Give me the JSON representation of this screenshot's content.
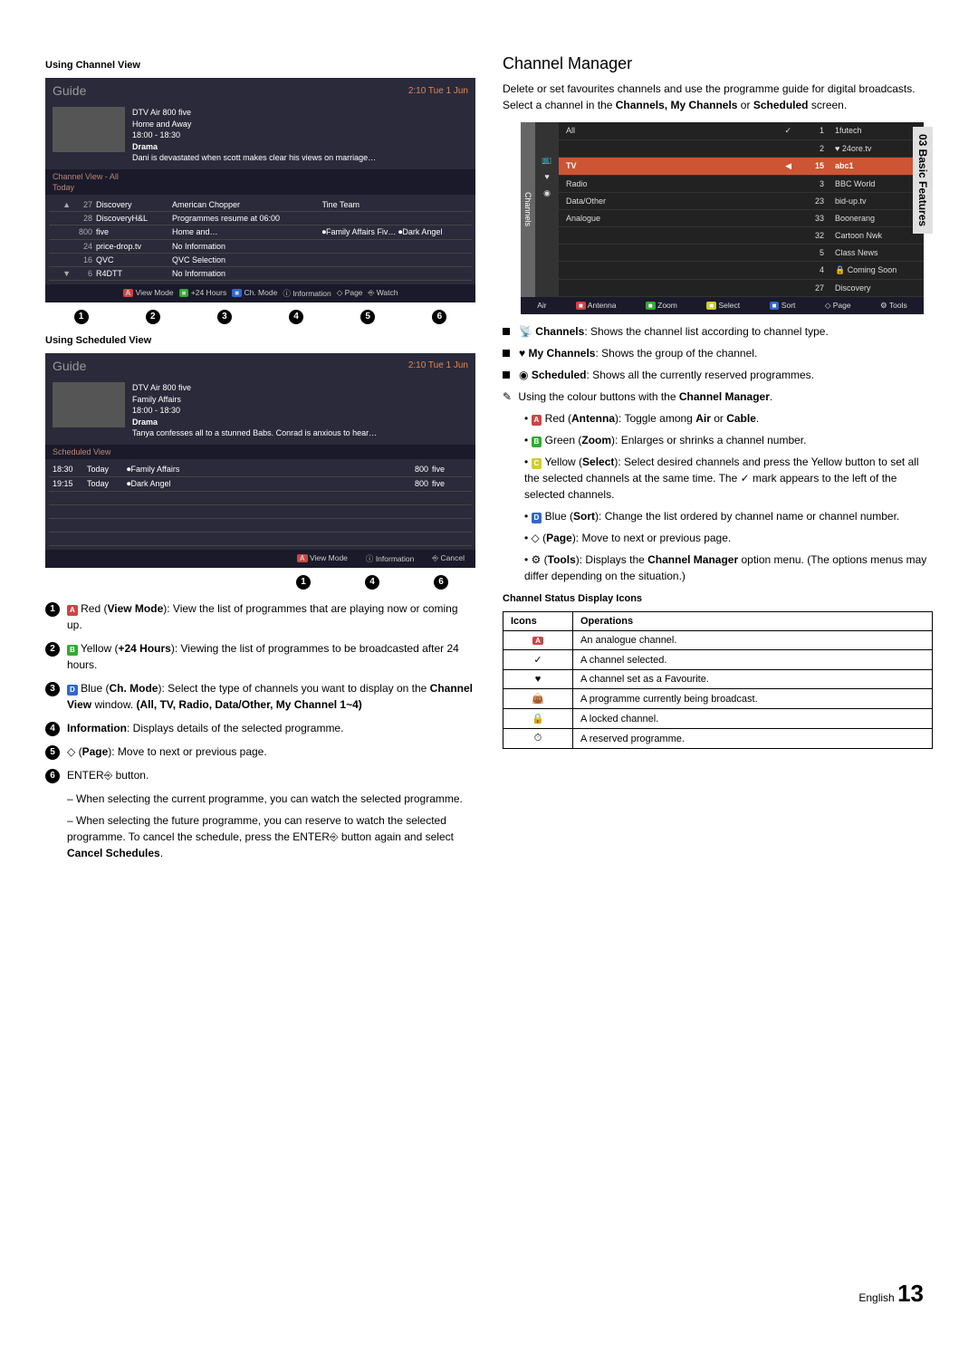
{
  "side_tab": "03 Basic Features",
  "page_footer_lang": "English",
  "page_footer_num": "13",
  "left": {
    "heading_cv": "Using Channel View",
    "heading_sv": "Using Scheduled View",
    "guide_title": "Guide",
    "guide_time": "2:10 Tue 1 Jun",
    "cv_preview": {
      "line1": "DTV Air 800 five",
      "line2": "Home and Away",
      "line3": "18:00 - 18:30",
      "line4_bold": "Drama",
      "line5": "Dani is devastated when scott makes clear his views on marriage…"
    },
    "cv_header": "Channel View - All",
    "cv_today": "Today",
    "cv_rows": [
      {
        "arrow": "▲",
        "num": "27",
        "name": "Discovery",
        "a": "American Chopper",
        "b": "Tine Team"
      },
      {
        "arrow": "",
        "num": "28",
        "name": "DiscoveryH&L",
        "a": "Programmes resume at 06:00",
        "b": ""
      },
      {
        "arrow": "",
        "num": "800",
        "name": "five",
        "a": "Home and…",
        "b": "⏺Family Affairs   Fiv…   ⏺Dark Angel"
      },
      {
        "arrow": "",
        "num": "24",
        "name": "price-drop.tv",
        "a": "No Information",
        "b": ""
      },
      {
        "arrow": "",
        "num": "16",
        "name": "QVC",
        "a": "QVC Selection",
        "b": ""
      },
      {
        "arrow": "▼",
        "num": "6",
        "name": "R4DTT",
        "a": "No Information",
        "b": ""
      }
    ],
    "cv_legend": {
      "viewmode_btn": "A",
      "viewmode": "View Mode",
      "hours_btn": "■",
      "hours": "+24 Hours",
      "chmode_btn": "■",
      "chmode": "Ch. Mode",
      "info_icon": "ⓘ",
      "info": "Information",
      "page_icon": "◇",
      "page": "Page",
      "watch_icon": "⎆",
      "watch": "Watch"
    },
    "callouts_row": [
      "1",
      "2",
      "3",
      "4",
      "5",
      "6"
    ],
    "sv_preview": {
      "line1": "DTV Air 800 five",
      "line2": "Family Affairs",
      "line3": "18:00 - 18:30",
      "line4_bold": "Drama",
      "line5": "Tanya confesses all to a stunned Babs. Conrad is anxious to hear…"
    },
    "sv_header": "Scheduled View",
    "sv_rows": [
      {
        "t": "18:30",
        "d": "Today",
        "p": "⏺Family Affairs",
        "c1": "800",
        "c2": "five"
      },
      {
        "t": "19:15",
        "d": "Today",
        "p": "⏺Dark Angel",
        "c1": "800",
        "c2": "five"
      }
    ],
    "sv_legend": {
      "viewmode_btn": "A",
      "viewmode": "View Mode",
      "info_icon": "ⓘ",
      "info": "Information",
      "cancel_icon": "⎆",
      "cancel": "Cancel"
    },
    "sv_callouts": [
      "1",
      "4",
      "6"
    ],
    "descriptions": {
      "d1_btn": "A",
      "d1_lead": "Red (",
      "d1_bold": "View Mode",
      "d1_tail": "): View the list of programmes that are playing now or coming up.",
      "d2_btn": "B",
      "d2_lead": "Yellow (",
      "d2_bold": "+24 Hours",
      "d2_tail": "): Viewing the list of programmes to be broadcasted after 24 hours.",
      "d3_btn": "D",
      "d3_lead": "Blue (",
      "d3_bold": "Ch. Mode",
      "d3_tail_a": "): Select the type of channels you want to display on the ",
      "d3_bold2": "Channel View",
      "d3_tail_b": " window. ",
      "d3_bold3": "(All, TV, Radio, Data/Other, My Channel 1~4)",
      "d4_bold": "Information",
      "d4_tail": ": Displays details of the selected programme.",
      "d5_icon": "◇",
      "d5_lead": " (",
      "d5_bold": "Page",
      "d5_tail": "): Move to next or previous page.",
      "d6_lead": "ENTER",
      "d6_icon": "⎆",
      "d6_tail": " button.",
      "d6_sub1": "When selecting the current programme, you can watch the selected programme.",
      "d6_sub2_a": "When selecting the future programme, you can reserve to watch the selected programme. To cancel the schedule, press the ENTER",
      "d6_sub2_icon": "⎆",
      "d6_sub2_b": " button again and select ",
      "d6_sub2_bold": "Cancel Schedules",
      "d6_sub2_c": "."
    }
  },
  "right": {
    "title": "Channel Manager",
    "intro_a": "Delete or set favourites channels and use the programme guide for digital broadcasts. Select a channel in the ",
    "intro_b_bold": "Channels, My Channels",
    "intro_c": " or ",
    "intro_d_bold": "Scheduled",
    "intro_e": " screen.",
    "cm_sidebar": "Channels",
    "cm_rows": [
      {
        "sym": "",
        "cat": "All",
        "col3": "✓",
        "num": "1",
        "name": "1futech"
      },
      {
        "sym": "",
        "cat": "",
        "col3": "",
        "num": "2",
        "name": "♥ 24ore.tv"
      },
      {
        "sym": "📺",
        "cat": "TV",
        "col3": "◀",
        "num": "15",
        "name": "abc1",
        "sel": true
      },
      {
        "sym": "♥",
        "cat": "Radio",
        "col3": "",
        "num": "3",
        "name": "BBC World"
      },
      {
        "sym": "",
        "cat": "Data/Other",
        "col3": "",
        "num": "23",
        "name": "bid-up.tv"
      },
      {
        "sym": "◉",
        "cat": "Analogue",
        "col3": "",
        "num": "33",
        "name": "Boonerang"
      },
      {
        "sym": "",
        "cat": "",
        "col3": "",
        "num": "32",
        "name": "Cartoon Nwk"
      },
      {
        "sym": "",
        "cat": "",
        "col3": "",
        "num": "5",
        "name": "Class News"
      },
      {
        "sym": "",
        "cat": "",
        "col3": "",
        "num": "4",
        "name": "🔒 Coming Soon"
      },
      {
        "sym": "",
        "cat": "",
        "col3": "",
        "num": "27",
        "name": "Discovery"
      }
    ],
    "cm_legend": {
      "air": "Air",
      "ant_btn": "■",
      "ant": "Antenna",
      "zoom_btn": "■",
      "zoom": "Zoom",
      "sel_btn": "■",
      "sel": "Select",
      "sort_btn": "■",
      "sort": "Sort",
      "page_icon": "◇",
      "page": "Page",
      "tools_icon": "⚙",
      "tools": "Tools"
    },
    "bullets": {
      "b1_icon": "📡",
      "b1_bold": "Channels",
      "b1_text": ": Shows the channel list according to channel type.",
      "b2_icon": "♥",
      "b2_bold": "My Channels",
      "b2_text": ": Shows the group of the channel.",
      "b3_icon": "◉",
      "b3_bold": "Scheduled",
      "b3_text": ": Shows all the currently reserved programmes."
    },
    "note_line_a": "Using the colour buttons with the ",
    "note_line_bold": "Channel Manager",
    "note_line_b": ".",
    "color": {
      "c1_btn": "A",
      "c1_a": "Red (",
      "c1_bold": "Antenna",
      "c1_b": "): Toggle among ",
      "c1_bold2": "Air",
      "c1_c": " or ",
      "c1_bold3": "Cable",
      "c1_d": ".",
      "c2_btn": "B",
      "c2_a": "Green (",
      "c2_bold": "Zoom",
      "c2_b": "): Enlarges or shrinks a channel number.",
      "c3_btn": "C",
      "c3_a": "Yellow (",
      "c3_bold": "Select",
      "c3_b": "): Select desired channels and press the Yellow button to set all the selected channels at the same time. The ✓ mark appears to the left of the selected channels.",
      "c4_btn": "D",
      "c4_a": "Blue (",
      "c4_bold": "Sort",
      "c4_b": "): Change the list ordered by channel name or channel number.",
      "c5_icon": "◇",
      "c5_a": " (",
      "c5_bold": "Page",
      "c5_b": "): Move to next or previous page.",
      "c6_icon": "⚙",
      "c6_a": " (",
      "c6_bold": "Tools",
      "c6_b": "): Displays the ",
      "c6_bold2": "Channel Manager",
      "c6_c": " option menu. (The options menus may differ depending on the situation.)"
    },
    "table_heading": "Channel Status Display Icons",
    "table": {
      "th1": "Icons",
      "th2": "Operations",
      "r1_icon": "A",
      "r1": "An analogue channel.",
      "r2_icon": "✓",
      "r2": "A channel selected.",
      "r3_icon": "♥",
      "r3": "A channel set as a Favourite.",
      "r4_icon": "👜",
      "r4": "A programme currently being broadcast.",
      "r5_icon": "🔒",
      "r5": "A locked channel.",
      "r6_icon": "⏱",
      "r6": "A reserved programme."
    }
  }
}
